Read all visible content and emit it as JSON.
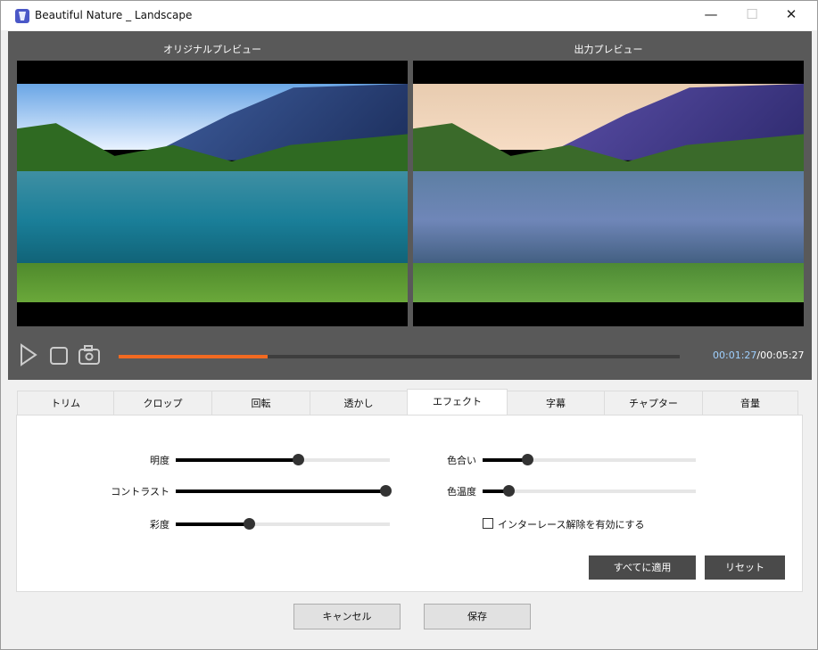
{
  "window": {
    "title": "Beautiful Nature _ Landscape",
    "minimize": "—",
    "maximize": "☐",
    "close": "✕"
  },
  "preview": {
    "original_label": "オリジナルプレビュー",
    "output_label": "出力プレビュー"
  },
  "playback": {
    "current_time": "00:01:27",
    "total_time": "/00:05:27",
    "progress_percent": 26.6
  },
  "tabs": [
    {
      "label": "トリム"
    },
    {
      "label": "クロップ"
    },
    {
      "label": "回転"
    },
    {
      "label": "透かし"
    },
    {
      "label": "エフェクト",
      "active": true
    },
    {
      "label": "字幕"
    },
    {
      "label": "チャプター"
    },
    {
      "label": "音量"
    }
  ],
  "effects": {
    "brightness": {
      "label": "明度",
      "value": 57
    },
    "contrast": {
      "label": "コントラスト",
      "value": 98
    },
    "saturation": {
      "label": "彩度",
      "value": 34
    },
    "hue": {
      "label": "色合い",
      "value": 21
    },
    "temperature": {
      "label": "色温度",
      "value": 12
    },
    "deinterlace": {
      "label": "インターレース解除を有効にする",
      "checked": false
    },
    "apply_all": "すべてに適用",
    "reset": "リセット"
  },
  "footer": {
    "cancel": "キャンセル",
    "save": "保存"
  },
  "colors": {
    "accent": "#f26a21",
    "dark_bg": "#595959"
  }
}
